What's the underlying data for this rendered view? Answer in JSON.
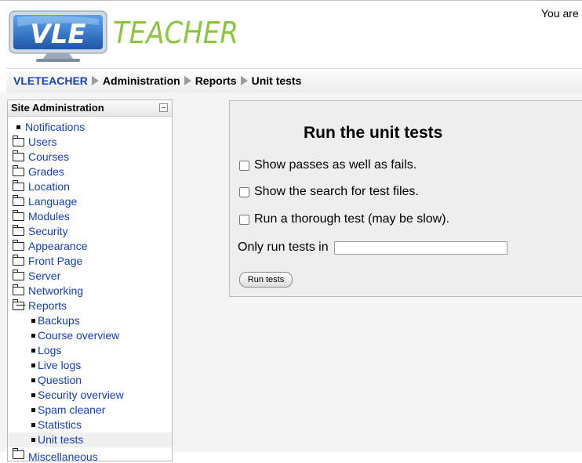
{
  "header": {
    "login_text": "You are l",
    "logo": {
      "part1": "VLE",
      "part2": "TEACHER"
    }
  },
  "navbar": {
    "breadcrumbs": [
      "VLETEACHER",
      "Administration",
      "Reports",
      "Unit tests"
    ]
  },
  "sidebar": {
    "title": "Site Administration",
    "items": [
      {
        "label": "Notifications",
        "type": "leaf",
        "level": 0
      },
      {
        "label": "Users",
        "type": "folder",
        "level": 0
      },
      {
        "label": "Courses",
        "type": "folder",
        "level": 0
      },
      {
        "label": "Grades",
        "type": "folder",
        "level": 0
      },
      {
        "label": "Location",
        "type": "folder",
        "level": 0
      },
      {
        "label": "Language",
        "type": "folder",
        "level": 0
      },
      {
        "label": "Modules",
        "type": "folder",
        "level": 0
      },
      {
        "label": "Security",
        "type": "folder",
        "level": 0
      },
      {
        "label": "Appearance",
        "type": "folder",
        "level": 0
      },
      {
        "label": "Front Page",
        "type": "folder",
        "level": 0
      },
      {
        "label": "Server",
        "type": "folder",
        "level": 0
      },
      {
        "label": "Networking",
        "type": "folder",
        "level": 0
      },
      {
        "label": "Reports",
        "type": "folder-open",
        "level": 0
      },
      {
        "label": "Backups",
        "type": "leaf",
        "level": 1
      },
      {
        "label": "Course overview",
        "type": "leaf",
        "level": 1
      },
      {
        "label": "Logs",
        "type": "leaf",
        "level": 1
      },
      {
        "label": "Live logs",
        "type": "leaf",
        "level": 1
      },
      {
        "label": "Question",
        "type": "leaf",
        "level": 1
      },
      {
        "label": "Security overview",
        "type": "leaf",
        "level": 1
      },
      {
        "label": "Spam cleaner",
        "type": "leaf",
        "level": 1
      },
      {
        "label": "Statistics",
        "type": "leaf",
        "level": 1
      },
      {
        "label": "Unit tests",
        "type": "leaf",
        "level": 1,
        "active": true
      },
      {
        "label": "Miscellaneous",
        "type": "folder",
        "level": 0
      }
    ]
  },
  "main": {
    "heading": "Run the unit tests",
    "options": [
      {
        "label": "Show passes as well as fails.",
        "checked": false
      },
      {
        "label": "Show the search for test files.",
        "checked": false
      },
      {
        "label": "Run a thorough test (may be slow).",
        "checked": false
      }
    ],
    "path_label": "Only run tests in",
    "path_value": "",
    "run_button": "Run tests"
  },
  "colors": {
    "link": "#1540b4",
    "logo_blue": "#1f63b8",
    "logo_green": "#8cc63f"
  }
}
